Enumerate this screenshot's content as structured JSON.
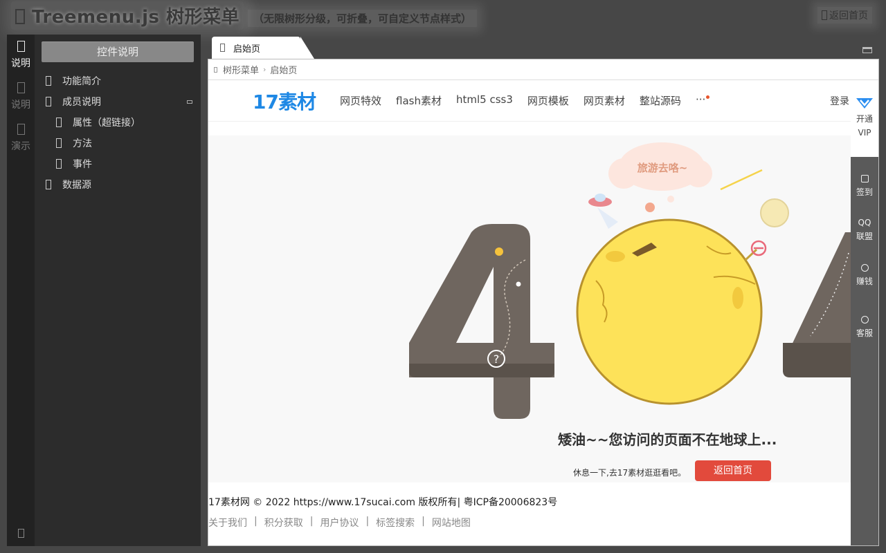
{
  "header": {
    "title": "Treemenu.js 树形菜单",
    "subtitle": "（无限树形分级，可折叠，可自定义节点样式）",
    "back_home": "返回首页"
  },
  "rail": {
    "items": [
      {
        "label": "说明"
      },
      {
        "label": "说明"
      },
      {
        "label": "演示"
      }
    ]
  },
  "sidebar": {
    "header": "控件说明",
    "tree": [
      {
        "label": "功能简介"
      },
      {
        "label": "成员说明"
      },
      {
        "label": "属性（超链接）"
      },
      {
        "label": "方法"
      },
      {
        "label": "事件"
      },
      {
        "label": "数据源"
      }
    ]
  },
  "tabs": [
    {
      "label": "启始页"
    }
  ],
  "breadcrumb": {
    "items": [
      "树形菜单",
      "启始页"
    ],
    "separator": "›"
  },
  "site": {
    "logo": "17素材",
    "nav": [
      "网页特效",
      "flash素材",
      "html5 css3",
      "网页模板",
      "网页素材",
      "整站源码"
    ],
    "more": "···",
    "login": "登录",
    "illustration": {
      "bubble_text": "旅游去咯~"
    },
    "error_message": "矮油~~您访问的页面不在地球上...",
    "error_sub": "休息一下,去17素材逛逛看吧。",
    "home_button": "返回首页",
    "footer": {
      "copyright": "17素材网 © 2022 https://www.17sucai.com 版权所有| 粤ICP备20006823号",
      "links": [
        "关于我们",
        "积分获取",
        "用户协议",
        "标签搜索",
        "网站地图"
      ]
    }
  },
  "side_tools": {
    "vip": [
      "开通",
      "VIP"
    ],
    "items": [
      {
        "label": "签到"
      },
      {
        "label": "QQ\n联盟"
      },
      {
        "label": "赚钱"
      },
      {
        "label": "客服"
      }
    ]
  },
  "colors": {
    "brand_blue": "#1e88e5",
    "button_red": "#e24a3c",
    "planet_yellow": "#fde259",
    "digit_brown": "#6f665f"
  }
}
